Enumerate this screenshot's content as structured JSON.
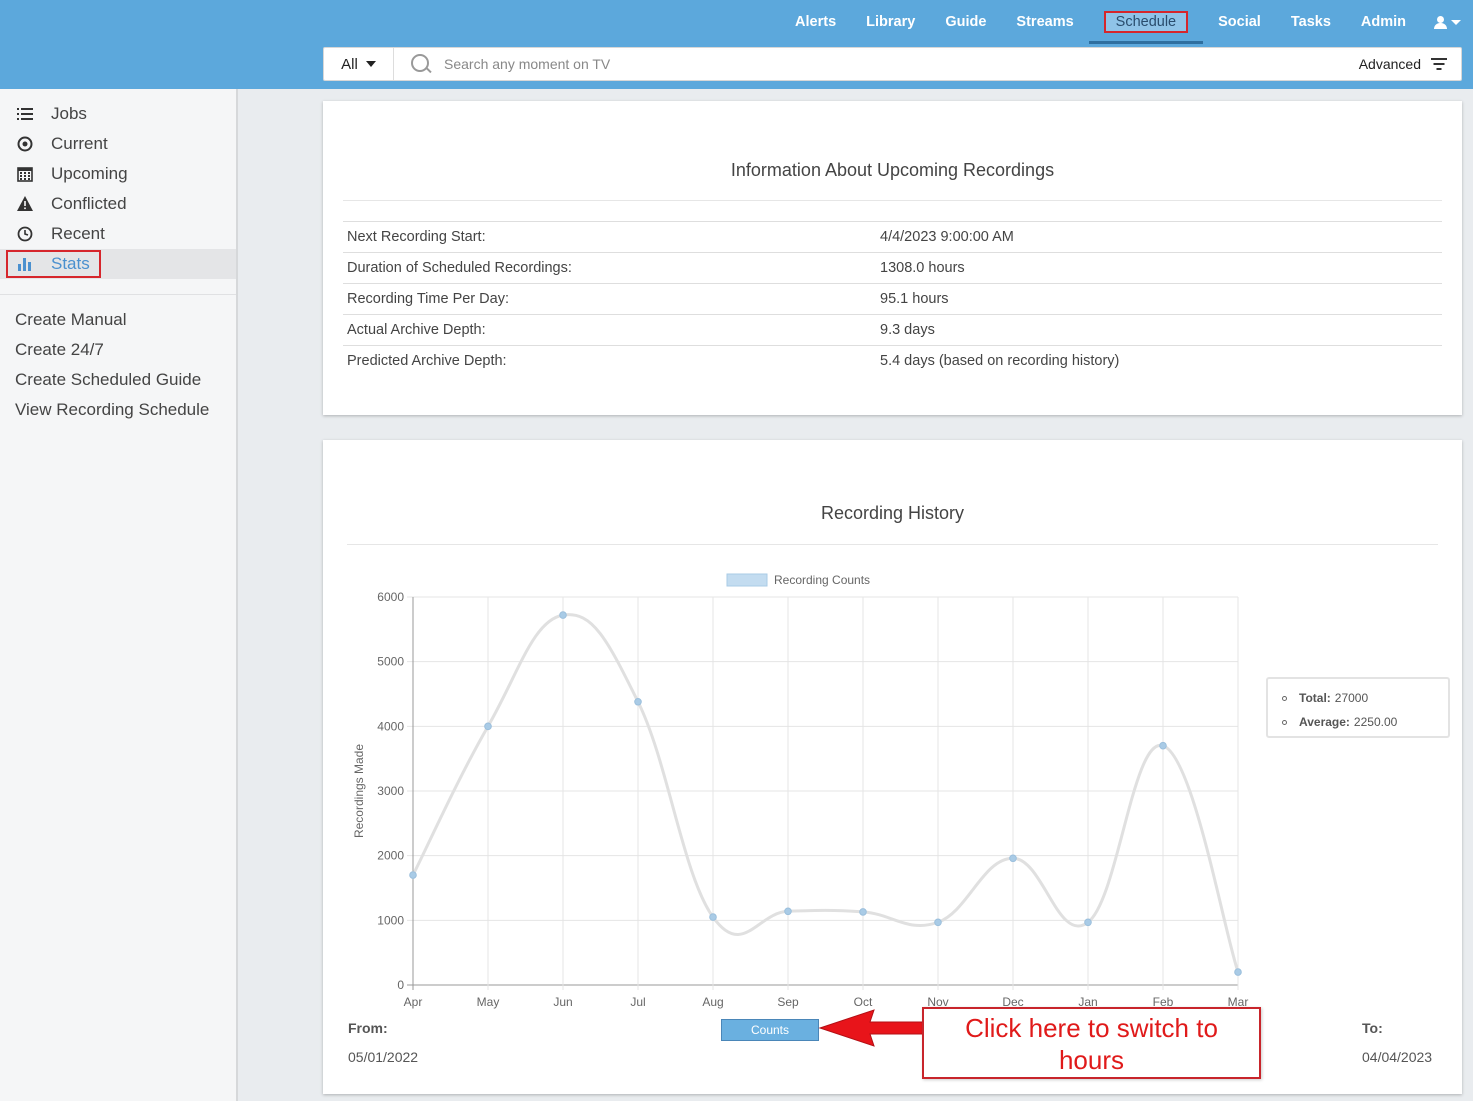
{
  "topnav": {
    "items": [
      "Alerts",
      "Library",
      "Guide",
      "Streams",
      "Schedule",
      "Social",
      "Tasks",
      "Admin"
    ],
    "active": "Schedule",
    "user_icon": "user-icon"
  },
  "search": {
    "scope": "All",
    "placeholder": "Search any moment on TV",
    "advanced_label": "Advanced"
  },
  "sidebar": {
    "items": [
      {
        "label": "Jobs",
        "icon": "list-icon"
      },
      {
        "label": "Current",
        "icon": "target-icon"
      },
      {
        "label": "Upcoming",
        "icon": "calendar-icon"
      },
      {
        "label": "Conflicted",
        "icon": "warning-icon"
      },
      {
        "label": "Recent",
        "icon": "clock-icon"
      },
      {
        "label": "Stats",
        "icon": "bar-chart-icon"
      }
    ],
    "active": "Stats",
    "links": [
      "Create Manual",
      "Create 24/7",
      "Create Scheduled Guide",
      "View Recording Schedule"
    ]
  },
  "info_card": {
    "title": "Information About Upcoming Recordings",
    "rows": [
      {
        "label": "Next Recording Start:",
        "value": "4/4/2023 9:00:00 AM"
      },
      {
        "label": "Duration of Scheduled Recordings:",
        "value": "1308.0 hours"
      },
      {
        "label": "Recording Time Per Day:",
        "value": "95.1 hours"
      },
      {
        "label": "Actual Archive Depth:",
        "value": "9.3 days"
      },
      {
        "label": "Predicted Archive Depth:",
        "value": "5.4 days (based on recording history)"
      }
    ]
  },
  "history_card": {
    "title": "Recording History",
    "summary": {
      "total_label": "Total:",
      "total_value": "27000",
      "average_label": "Average:",
      "average_value": "2250.00"
    },
    "from_label": "From:",
    "from_value": "05/01/2022",
    "to_label": "To:",
    "to_value": "04/04/2023",
    "toggle_label": "Counts",
    "callout_line1": "Click here to switch to",
    "callout_line2": "hours"
  },
  "colors": {
    "topbar": "#5ca8dc",
    "accent": "#4a90cf",
    "highlight_border": "#d6262c",
    "line": "#e0e0e0",
    "point": "#a9cbe6",
    "callout_text": "#e01a1a"
  },
  "chart_data": {
    "type": "line",
    "categories": [
      "Apr",
      "May",
      "Jun",
      "Jul",
      "Aug",
      "Sep",
      "Oct",
      "Nov",
      "Dec",
      "Jan",
      "Feb",
      "Mar"
    ],
    "series": [
      {
        "name": "Recording Counts",
        "values": [
          1700,
          4000,
          5720,
          4380,
          1050,
          1140,
          1130,
          970,
          1960,
          970,
          3700,
          200
        ]
      }
    ],
    "ylabel": "Recordings Made",
    "yticks": [
      0,
      1000,
      2000,
      3000,
      4000,
      5000,
      6000
    ],
    "ylim": [
      0,
      6000
    ],
    "grid": true,
    "legend": "top",
    "smooth": true
  }
}
